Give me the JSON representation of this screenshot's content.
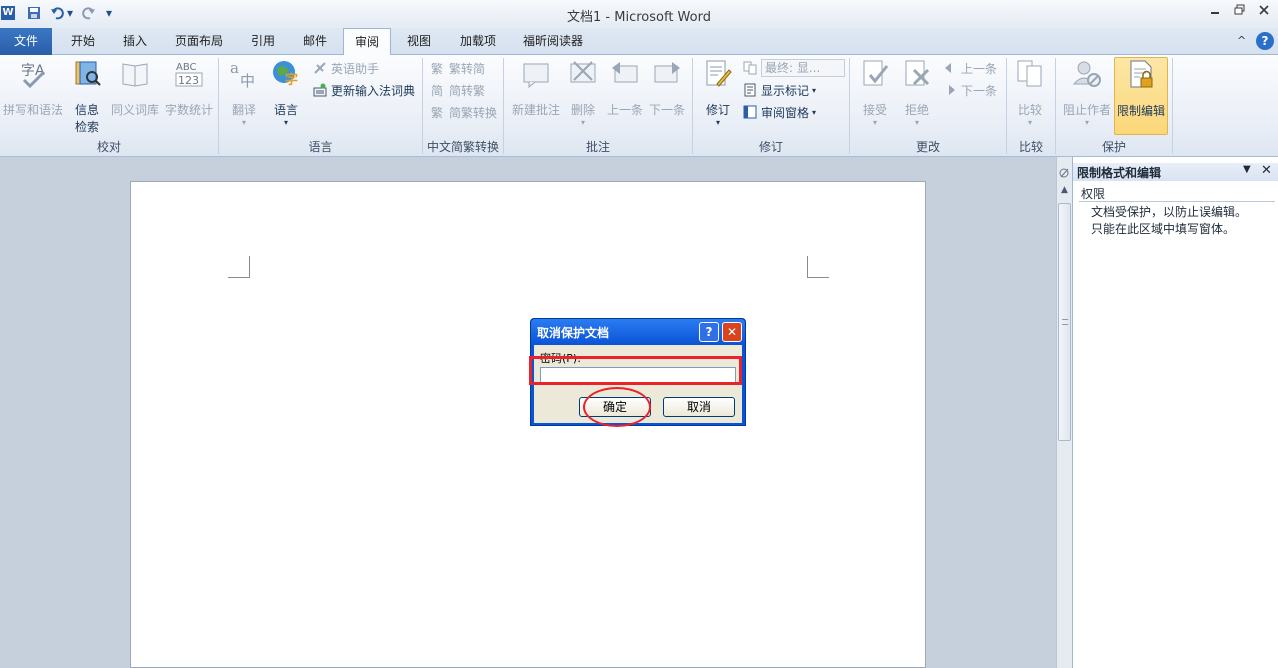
{
  "window": {
    "title": "文档1 - Microsoft Word"
  },
  "quick_access": {
    "word_icon": "W",
    "save_icon": "save-icon",
    "undo_icon": "undo-icon",
    "redo_icon": "redo-icon",
    "customize": "▾"
  },
  "tabs": [
    "文件",
    "开始",
    "插入",
    "页面布局",
    "引用",
    "邮件",
    "审阅",
    "视图",
    "加载项",
    "福昕阅读器"
  ],
  "active_tab": "审阅",
  "ribbon": {
    "groups": {
      "proofing": {
        "label": "校对",
        "spell": "拼写和语法",
        "research_1": "信息",
        "research_2": "检索",
        "thesaurus": "同义词库",
        "wordcount": "字数统计"
      },
      "language": {
        "label": "语言",
        "translate": "翻译",
        "language": "语言",
        "english_assistant": "英语助手",
        "update_ime": "更新输入法词典"
      },
      "chinese_conversion": {
        "label": "中文简繁转换",
        "to_simplified": "繁转简",
        "to_traditional": "简转繁",
        "convert": "简繁转换"
      },
      "comments": {
        "label": "批注",
        "new": "新建批注",
        "delete": "删除",
        "previous": "上一条",
        "next": "下一条"
      },
      "tracking": {
        "label": "修订",
        "track": "修订",
        "display_for_review": "最终: 显...",
        "show_markup": "显示标记",
        "reviewing_pane": "审阅窗格"
      },
      "changes": {
        "label": "更改",
        "accept": "接受",
        "reject": "拒绝",
        "previous": "上一条",
        "next": "下一条"
      },
      "compare": {
        "label": "比较",
        "compare": "比较"
      },
      "protect": {
        "label": "保护",
        "block_authors": "阻止作者",
        "restrict_editing": "限制编辑"
      }
    }
  },
  "task_pane": {
    "title": "限制格式和编辑",
    "section": "权限",
    "line1": "文档受保护，以防止误编辑。",
    "line2": "只能在此区域中填写窗体。"
  },
  "dialog": {
    "title": "取消保护文档",
    "help": "?",
    "close": "✕",
    "password_label": "密码(P):",
    "password_value": "",
    "ok": "确定",
    "cancel": "取消"
  },
  "colors": {
    "accent": "#2a5ea8",
    "highlight_red": "#e8242a",
    "dialog_blue": "#0a53d6",
    "active_button": "#fbd77a"
  }
}
